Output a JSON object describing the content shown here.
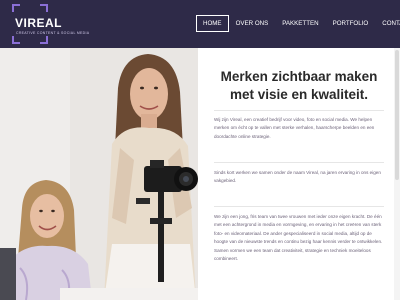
{
  "brand": {
    "name": "VIREAL",
    "tagline": "CREATIVE CONTENT & SOCIAL MEDIA",
    "accent_color": "#8a6fd6",
    "header_color": "#2e2a48"
  },
  "nav": {
    "items": [
      {
        "label": "HOME",
        "active": true
      },
      {
        "label": "OVER ONS",
        "active": false
      },
      {
        "label": "PAKKETTEN",
        "active": false
      },
      {
        "label": "PORTFOLIO",
        "active": false
      },
      {
        "label": "CONTACT",
        "active": false
      }
    ]
  },
  "main": {
    "heading": "Merken zichtbaar maken met visie en kwaliteit.",
    "paragraphs": [
      "Wij zijn Vireal, een creatief bedrijf voor video, foto en social media. We helpen merken om écht op te vallen met sterke verhalen, haarscherpe beelden en een doordachte online strategie.",
      "Sinds kort werken we samen onder de naam Vireal, na jaren ervaring in ons eigen vakgebied.",
      "We zijn een jong, fris team van twee vrouwen met ieder onze eigen kracht. De één met een achtergrond in media en vormgeving, en ervaring in het creëren van sterk foto- en videomateriaal. De ander gespecialiseerd in social media, altijd op de hoogte van de nieuwste trends en continu bezig haar kennis verder te ontwikkelen. Samen vormen we een team dat creativiteit, strategie en techniek moeiteloos combineert."
    ]
  },
  "photo": {
    "icon": "camera-icon"
  }
}
